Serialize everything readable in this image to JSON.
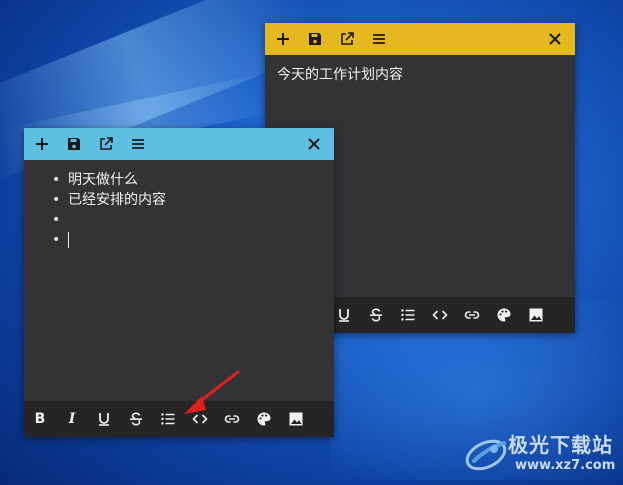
{
  "back_note": {
    "header": {
      "color": "#e6b81f"
    },
    "content": "今天的工作计划内容"
  },
  "front_note": {
    "header": {
      "color": "#5fbfe2"
    },
    "items": [
      "明天做什么",
      "已经安排的内容",
      "",
      ""
    ]
  },
  "toolbar": {
    "bold_label": "B",
    "italic_label": "I"
  },
  "watermark": {
    "title": "极光下载站",
    "url": "www.xz7.com"
  },
  "colors": {
    "note_bg": "#333336",
    "toolbar_bg": "#252526",
    "arrow": "#e02020"
  }
}
